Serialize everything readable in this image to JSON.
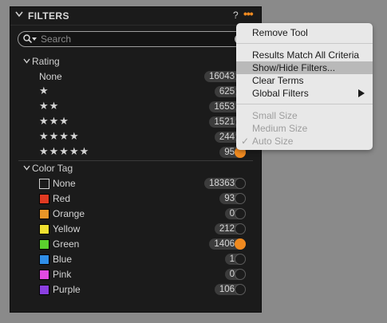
{
  "panel": {
    "title": "FILTERS",
    "help": "?",
    "more": "•••",
    "search_placeholder": "Search"
  },
  "rating": {
    "title": "Rating",
    "rows": [
      {
        "label": "None",
        "count": "16043",
        "knob_on": false
      },
      {
        "label": "★",
        "count": "625",
        "knob_on": false
      },
      {
        "label": "★★",
        "count": "1653",
        "knob_on": false
      },
      {
        "label": "★★★",
        "count": "1521",
        "knob_on": false
      },
      {
        "label": "★★★★",
        "count": "244",
        "knob_on": false
      },
      {
        "label": "★★★★★",
        "count": "95",
        "knob_on": true
      }
    ]
  },
  "color_tag": {
    "title": "Color Tag",
    "rows": [
      {
        "label": "None",
        "count": "18363",
        "color": "#1b1b1b",
        "knob_on": false
      },
      {
        "label": "Red",
        "count": "93",
        "color": "#e03a22",
        "knob_on": false
      },
      {
        "label": "Orange",
        "count": "0",
        "color": "#e89428",
        "knob_on": false
      },
      {
        "label": "Yellow",
        "count": "212",
        "color": "#f0e030",
        "knob_on": false
      },
      {
        "label": "Green",
        "count": "1406",
        "color": "#5ad12e",
        "knob_on": true
      },
      {
        "label": "Blue",
        "count": "1",
        "color": "#2f8ee8",
        "knob_on": false
      },
      {
        "label": "Pink",
        "count": "0",
        "color": "#e24be0",
        "knob_on": false
      },
      {
        "label": "Purple",
        "count": "106",
        "color": "#8a3fe0",
        "knob_on": false
      }
    ]
  },
  "menu": {
    "remove_tool": "Remove Tool",
    "results_match": "Results Match All Criteria",
    "show_hide": "Show/Hide Filters...",
    "clear_terms": "Clear Terms",
    "global_filters": "Global Filters",
    "small_size": "Small Size",
    "medium_size": "Medium Size",
    "auto_size": "Auto Size",
    "check": "✓"
  }
}
